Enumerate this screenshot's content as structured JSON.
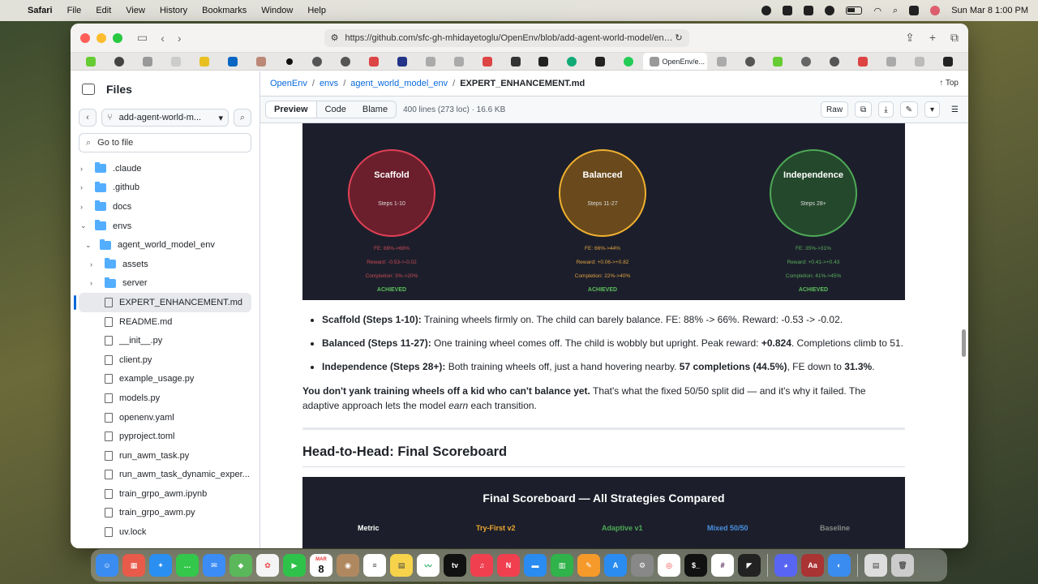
{
  "menubar": {
    "apple": "",
    "app": "Safari",
    "items": [
      "File",
      "Edit",
      "View",
      "History",
      "Bookmarks",
      "Window",
      "Help"
    ],
    "datetime": "Sun Mar 8  1:00 PM"
  },
  "browser": {
    "url": "https://github.com/sfc-gh-mhidayetoglu/OpenEnv/blob/add-agent-world-model/envs/ag",
    "active_tab": "OpenEnv/e..."
  },
  "sidebar": {
    "title": "Files",
    "branch": "add-agent-world-m...",
    "goto_placeholder": "Go to file",
    "items": [
      {
        "label": ".claude",
        "type": "folder"
      },
      {
        "label": ".github",
        "type": "folder"
      },
      {
        "label": "docs",
        "type": "folder"
      },
      {
        "label": "envs",
        "type": "folder"
      },
      {
        "label": "agent_world_model_env",
        "type": "folder"
      },
      {
        "label": "assets",
        "type": "folder"
      },
      {
        "label": "server",
        "type": "folder"
      },
      {
        "label": "EXPERT_ENHANCEMENT.md",
        "type": "file"
      },
      {
        "label": "README.md",
        "type": "file"
      },
      {
        "label": "__init__.py",
        "type": "file"
      },
      {
        "label": "client.py",
        "type": "file"
      },
      {
        "label": "example_usage.py",
        "type": "file"
      },
      {
        "label": "models.py",
        "type": "file"
      },
      {
        "label": "openenv.yaml",
        "type": "file"
      },
      {
        "label": "pyproject.toml",
        "type": "file"
      },
      {
        "label": "run_awm_task.py",
        "type": "file"
      },
      {
        "label": "run_awm_task_dynamic_exper...",
        "type": "file"
      },
      {
        "label": "train_grpo_awm.ipynb",
        "type": "file"
      },
      {
        "label": "train_grpo_awm.py",
        "type": "file"
      },
      {
        "label": "uv.lock",
        "type": "file"
      }
    ]
  },
  "breadcrumb": {
    "parts": [
      "OpenEnv",
      "envs",
      "agent_world_model_env"
    ],
    "current": "EXPERT_ENHANCEMENT.md",
    "top": "Top"
  },
  "filebar": {
    "tabs": [
      "Preview",
      "Code",
      "Blame"
    ],
    "meta": "400 lines (273 loc) · 16.6 KB",
    "raw": "Raw"
  },
  "phases": [
    {
      "name": "Scaffold",
      "steps": "Steps 1-10",
      "fe": "FE: 88%->66%",
      "reward": "Reward: -0.53->-0.02",
      "completion": "Completion: 3%->20%",
      "status": "ACHIEVED"
    },
    {
      "name": "Balanced",
      "steps": "Steps 11-27",
      "fe": "FE: 66%->44%",
      "reward": "Reward: +0.06->+0.82",
      "completion": "Completion: 22%->40%",
      "status": "ACHIEVED"
    },
    {
      "name": "Independence",
      "steps": "Steps 28+",
      "fe": "FE: 35%->31%",
      "reward": "Reward: +0.41->+0.43",
      "completion": "Completion: 41%->45%",
      "status": "ACHIEVED"
    }
  ],
  "bullets": [
    {
      "b": "Scaffold (Steps 1-10):",
      "t": " Training wheels firmly on. The child can barely balance. FE: 88% -> 66%. Reward: -0.53 -> -0.02."
    },
    {
      "b": "Balanced (Steps 11-27):",
      "t": " One training wheel comes off. The child is wobbly but upright. Peak reward: ",
      "b2": "+0.824",
      "t2": ". Completions climb to 51."
    },
    {
      "b": "Independence (Steps 28+):",
      "t": " Both training wheels off, just a hand hovering nearby. ",
      "b2": "57 completions (44.5%)",
      "t2": ", FE down to ",
      "b3": "31.3%",
      "t3": "."
    }
  ],
  "para": {
    "bold": "You don't yank training wheels off a kid who can't balance yet.",
    "text1": " That's what the fixed 50/50 split did — and it's why it failed. The adaptive approach lets the model ",
    "em": "earn",
    "text2": " each transition."
  },
  "heading2": "Head-to-Head: Final Scoreboard",
  "scoreboard": {
    "title": "Final Scoreboard — All Strategies Compared",
    "columns": [
      "Metric",
      "Try-First v2",
      "Adaptive v1",
      "Mixed 50/50",
      "Baseline"
    ]
  },
  "dock_apps": [
    "Finder",
    "Launchpad",
    "Safari",
    "Messages",
    "Mail",
    "Maps",
    "Photos",
    "FaceTime",
    "Calendar",
    "Contacts",
    "Reminders",
    "Notes",
    "Freeform",
    "TV",
    "Music",
    "News",
    "Keynote",
    "Numbers",
    "Pages",
    "App Store",
    "Settings",
    "Chrome",
    "Terminal",
    "Slack",
    "Cursor",
    "Discord",
    "Dictionary",
    "Preview",
    "Downloads",
    "Trash"
  ],
  "calendar_day": "8",
  "calendar_month": "MAR"
}
